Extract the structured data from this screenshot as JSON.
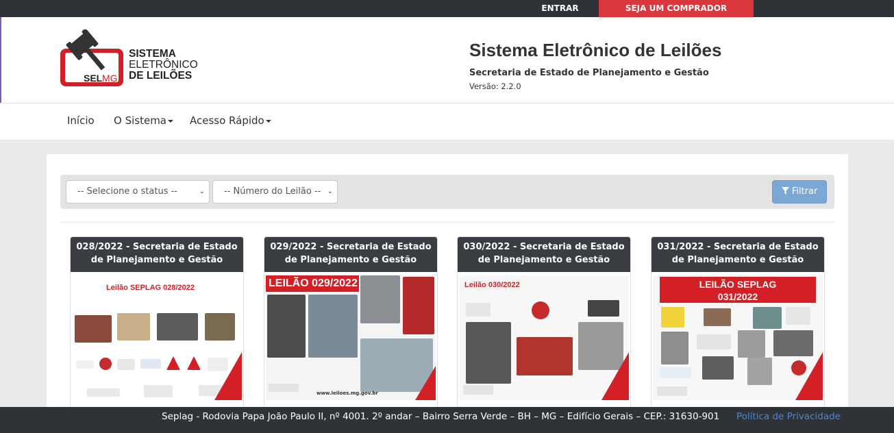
{
  "topbar": {
    "enter_label": "ENTRAR",
    "buyer_label": "SEJA UM COMPRADOR",
    "buyer_color": "#d9363e"
  },
  "logo": {
    "line1": "SISTEMA",
    "line2": "ELETRÔNICO",
    "line3": "DE LEILÕES",
    "badge_sel": "SEL",
    "badge_mg": "MG"
  },
  "header": {
    "title": "Sistema Eletrônico de Leilões",
    "subtitle": "Secretaria de Estado de Planejamento e Gestão",
    "version": "Versão: 2.2.0"
  },
  "nav": {
    "items": [
      {
        "label": "Início"
      },
      {
        "label": "O Sistema"
      },
      {
        "label": "Acesso Rápido"
      }
    ]
  },
  "filters": {
    "status_select": "-- Selecione o status --",
    "number_select": "-- Número do Leilão --",
    "filter_button": "Filtrar"
  },
  "cards": [
    {
      "title": "028/2022 - Secretaria de Estado de Planejamento e Gestão",
      "poster_title": "Leilão SEPLAG 028/2022"
    },
    {
      "title": "029/2022 - Secretaria de Estado de Planejamento e Gestão",
      "poster_title": "LEILÃO 029/2022",
      "poster_footer": "www.leiloes.mg.gov.br"
    },
    {
      "title": "030/2022 - Secretaria de Estado de Planejamento e Gestão",
      "poster_title": "Leilão 030/2022"
    },
    {
      "title": "031/2022 - Secretaria de Estado de Planejamento e Gestão",
      "poster_title_1": "LEILÃO SEPLAG",
      "poster_title_2": "031/2022"
    }
  ],
  "footer": {
    "address": "Seplag - Rodovia Papa João Paulo II, nº 4001. 2º andar – Bairro Serra Verde – BH – MG – Edifício Gerais – CEP.: 31630-901",
    "privacy_link": "Política de Privacidade"
  },
  "colors": {
    "dark": "#2f3236",
    "red": "#d32027",
    "filter_button": "#7aa7d4",
    "link": "#4a87d6"
  }
}
